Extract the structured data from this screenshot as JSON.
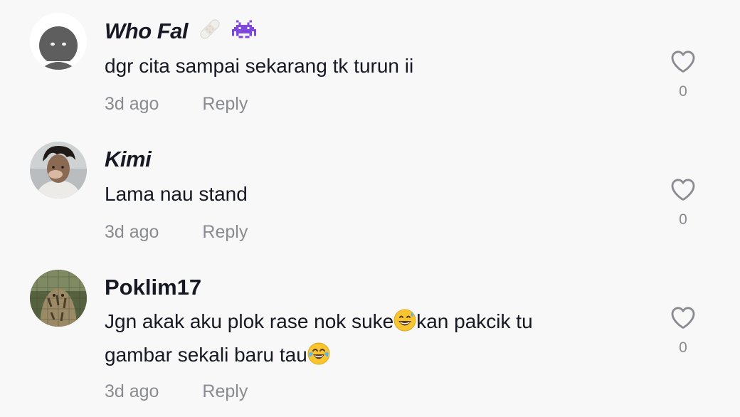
{
  "comments": [
    {
      "username": "Who Fal",
      "username_emojis": [
        "bandage-emoji",
        "alien-monster-emoji"
      ],
      "text": "dgr cita sampai sekarang tk turun ii",
      "time": "3d ago",
      "reply": "Reply",
      "likes": "0"
    },
    {
      "username": "Kimi",
      "text": "Lama nau stand",
      "time": "3d ago",
      "reply": "Reply",
      "likes": "0"
    },
    {
      "username": "Poklim17",
      "text_part1": "Jgn akak aku plok rase nok suke",
      "text_part2": "kan pakcik tu",
      "text_part3": "gambar sekali baru tau",
      "inline_emojis": [
        "grinning-sweat-emoji",
        "tears-of-joy-emoji"
      ],
      "time": "3d ago",
      "reply": "Reply",
      "likes": "0"
    }
  ],
  "colors": {
    "background": "#f8f8f8",
    "text": "#161823",
    "meta": "#8a8b91",
    "heart_stroke": "#8a8b91"
  }
}
